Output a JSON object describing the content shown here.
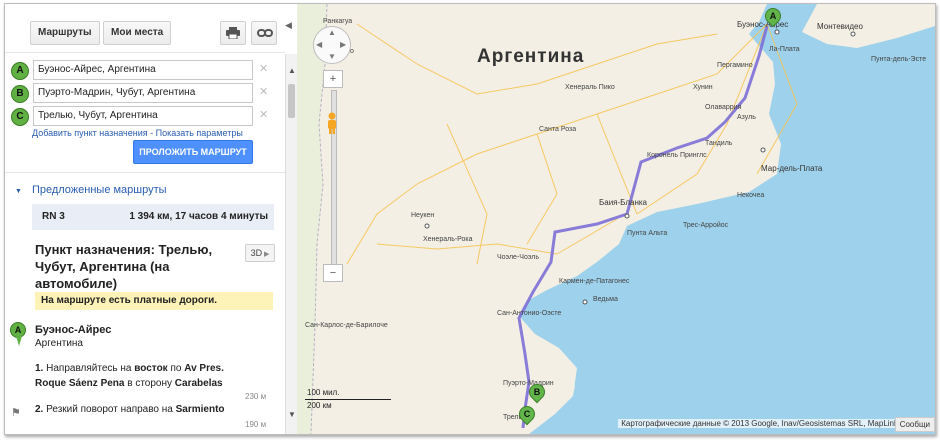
{
  "toolbar": {
    "routes_button": "Маршруты",
    "myplaces_button": "Мои места"
  },
  "waypoints": [
    {
      "marker": "A",
      "value": "Буэнос-Айрес, Аргентина"
    },
    {
      "marker": "B",
      "value": "Пуэрто-Мадрин, Чубут, Аргентина"
    },
    {
      "marker": "C",
      "value": "Трелью, Чубут, Аргентина"
    }
  ],
  "links": {
    "add_destination": "Добавить пункт назначения",
    "separator": "-",
    "show_options": "Показать параметры"
  },
  "route_button": "ПРОЛОЖИТЬ МАРШРУТ",
  "suggested": {
    "title": "Предложенные маршруты",
    "route_name": "RN 3",
    "route_info": "1 394 км, 17 часов 4 минуты"
  },
  "destination": {
    "title": "Пункт назначения: Трелью, Чубут, Аргентина (на автомобиле)",
    "view_3d": "3D",
    "toll_notice": "На маршруте есть платные дороги."
  },
  "start": {
    "marker": "A",
    "name": "Буэнос-Айрес",
    "country": "Аргентина"
  },
  "steps": [
    {
      "num": "1.",
      "parts": [
        "Направляйтесь на ",
        "восток",
        " по ",
        "Av Pres. Roque Sáenz Pena",
        " в сторону ",
        "Carabelas"
      ],
      "distance": "230 м"
    },
    {
      "num": "2.",
      "parts": [
        "Резкий поворот направо на ",
        "Sarmiento"
      ],
      "distance": "190 м"
    }
  ],
  "map": {
    "country_label": "Аргентина",
    "places": [
      {
        "name": "Ранкагуа",
        "cls": "p1"
      },
      {
        "name": "Куричо",
        "cls": "p2"
      },
      {
        "name": "Буэнос-Айрес",
        "cls": "p3"
      },
      {
        "name": "Монтевидео",
        "cls": "p4"
      },
      {
        "name": "Ла-Плата",
        "cls": "p5"
      },
      {
        "name": "Пунта-дель-Эсте",
        "cls": "p6"
      },
      {
        "name": "Хенераль Пико",
        "cls": "p7"
      },
      {
        "name": "Санта Роза",
        "cls": "p8"
      },
      {
        "name": "Тандиль",
        "cls": "p9"
      },
      {
        "name": "Мар-дель-Плата",
        "cls": "p10"
      },
      {
        "name": "Коронель Принглс",
        "cls": "p11"
      },
      {
        "name": "Баия-Бланка",
        "cls": "p12"
      },
      {
        "name": "Трес-Арройос",
        "cls": "p13"
      },
      {
        "name": "Пунта Альта",
        "cls": "p14"
      },
      {
        "name": "Неукен",
        "cls": "p15"
      },
      {
        "name": "Хенераль-Рока",
        "cls": "p16"
      },
      {
        "name": "Ведьма",
        "cls": "p17"
      },
      {
        "name": "Сан-Карлос-де-Барилоче",
        "cls": "p18"
      },
      {
        "name": "Пуэрто-Мадрин",
        "cls": "p19"
      },
      {
        "name": "Трелью",
        "cls": "p20"
      },
      {
        "name": "Хунин",
        "cls": "p21"
      },
      {
        "name": "Пергамино",
        "cls": "p22"
      },
      {
        "name": "Олаваррия",
        "cls": "p23"
      },
      {
        "name": "Азуль",
        "cls": "p24"
      },
      {
        "name": "Некочеа",
        "cls": "p25"
      },
      {
        "name": "Чоэле-Чоэль",
        "cls": "p26"
      },
      {
        "name": "Кармен-де-Патагонес",
        "cls": "p27"
      },
      {
        "name": "Сан-Антонио-Оэсте",
        "cls": "p28"
      }
    ],
    "scale_mi": "100 мил.",
    "scale_km": "200 км",
    "copyright": "Картографические данные © 2013 Google, Inav/Geosistemas SRL, MapLink",
    "report": "Сообщи"
  },
  "colors": {
    "route": "#7c6fd6",
    "land": "#f3efe4",
    "water": "#9ed1eb",
    "marker": "#62b54a",
    "button": "#4d90fe"
  }
}
